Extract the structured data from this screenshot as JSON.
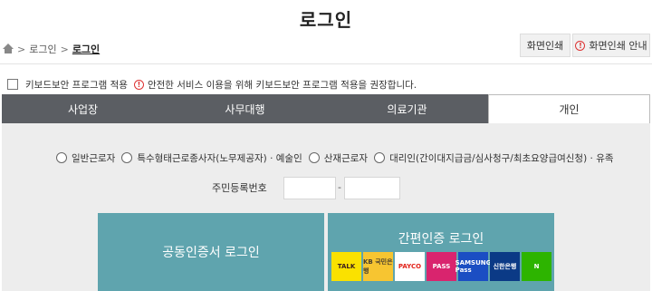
{
  "page": {
    "title": "로그인"
  },
  "breadcrumb": {
    "items": [
      "로그인",
      "로그인"
    ]
  },
  "toolbar": {
    "print_label": "화면인쇄",
    "print_guide_label": "화면인쇄 안내"
  },
  "keyboard": {
    "checkbox_label": "키보드보안 프로그램 적용",
    "notice": "안전한 서비스 이용을 위해 키보드보안 프로그램 적용을 권장합니다.",
    "warn_glyph": "!"
  },
  "tabs": [
    {
      "label": "사업장",
      "active": false
    },
    {
      "label": "사무대행",
      "active": false
    },
    {
      "label": "의료기관",
      "active": false
    },
    {
      "label": "개인",
      "active": true
    }
  ],
  "user_types": [
    "일반근로자",
    "특수형태근로종사자(노무제공자) · 예술인",
    "산재근로자",
    "대리인(간이대지급금/심사청구/최초요양급여신청) · 유족"
  ],
  "id_field": {
    "label": "주민등록번호",
    "separator": "-",
    "first": "",
    "second": ""
  },
  "login": {
    "cert_label": "공동인증서 로그인",
    "simple_label": "간편인증 로그인",
    "providers": [
      {
        "name": "kakaotalk-icon",
        "text": "TALK",
        "bg": "#fae100",
        "fg": "#3c1e1e"
      },
      {
        "name": "kb-icon",
        "text": "KB 국민은행",
        "bg": "#f7c531",
        "fg": "#4a3f2c"
      },
      {
        "name": "payco-icon",
        "text": "PAYCO",
        "bg": "#ffffff",
        "fg": "#e2231a"
      },
      {
        "name": "pass-icon",
        "text": "PASS",
        "bg": "#d9246e",
        "fg": "#ffffff"
      },
      {
        "name": "samsung-pass-icon",
        "text": "SAMSUNG Pass",
        "bg": "#1b4ec3",
        "fg": "#ffffff"
      },
      {
        "name": "shinhan-icon",
        "text": "신한은행",
        "bg": "#0b3a86",
        "fg": "#ffffff"
      },
      {
        "name": "naver-icon",
        "text": "N",
        "bg": "#2db400",
        "fg": "#ffffff"
      }
    ]
  }
}
